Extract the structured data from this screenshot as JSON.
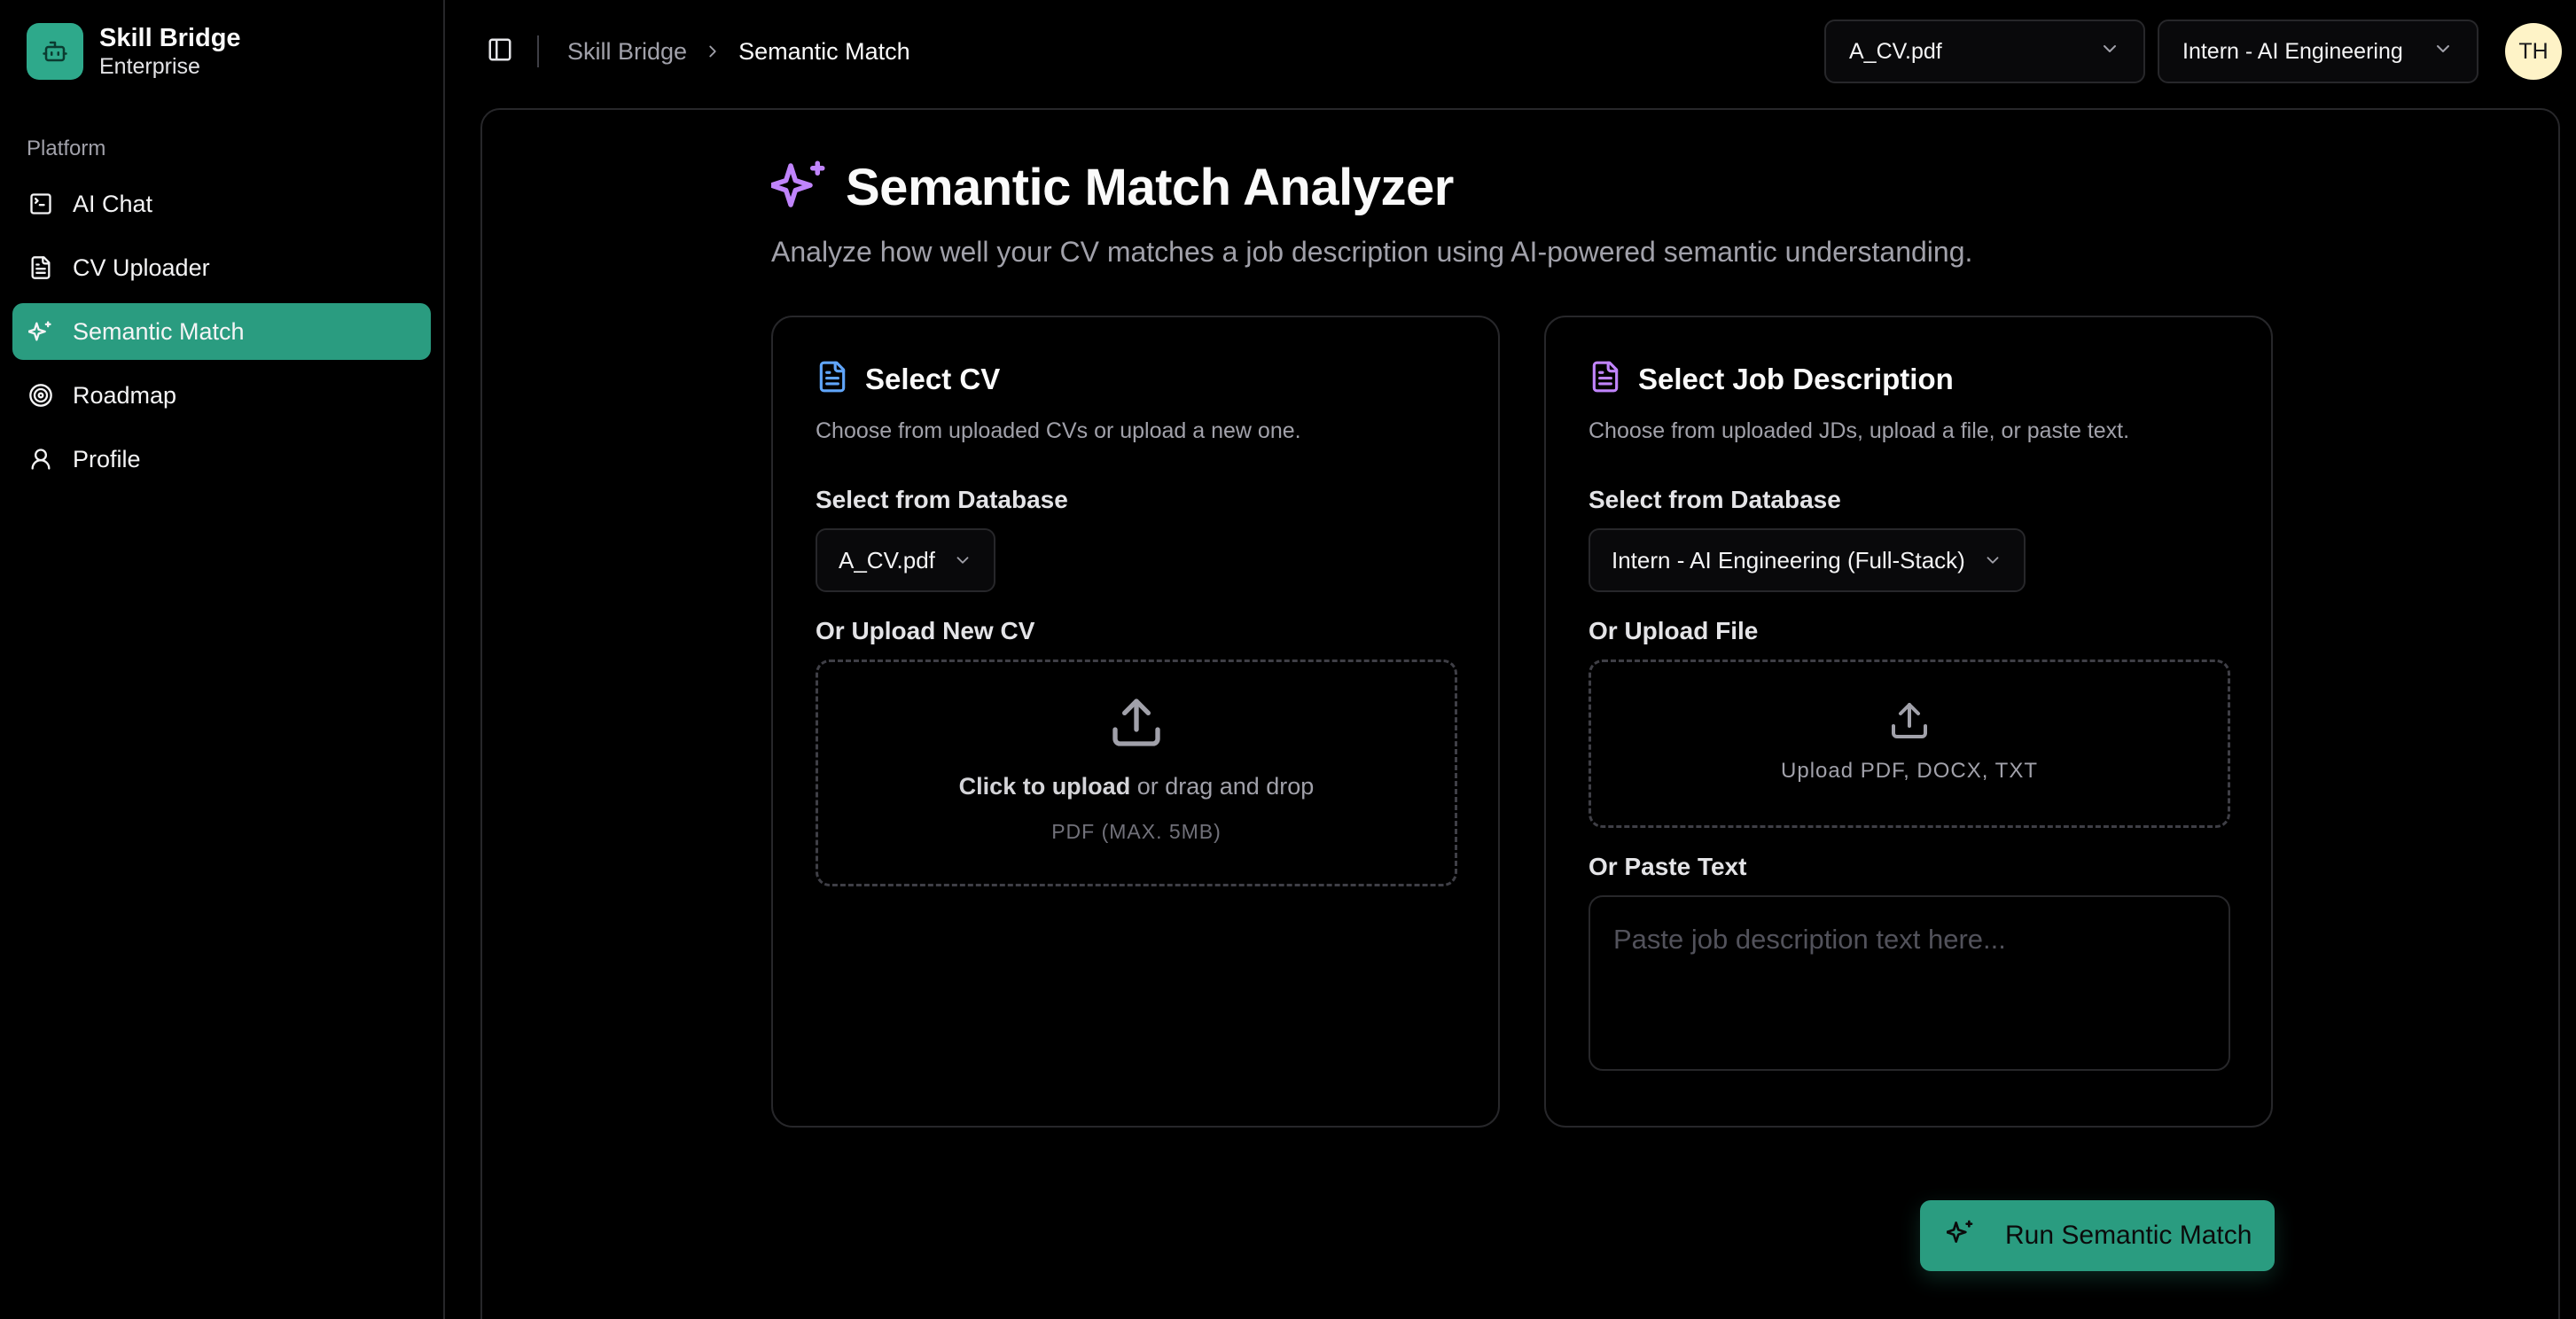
{
  "app": {
    "name": "Skill Bridge",
    "plan": "Enterprise"
  },
  "sidebar": {
    "group_label": "Platform",
    "items": [
      {
        "label": "AI Chat",
        "icon": "terminal-icon",
        "active": false
      },
      {
        "label": "CV Uploader",
        "icon": "file-icon",
        "active": false
      },
      {
        "label": "Semantic Match",
        "icon": "sparkles-icon",
        "active": true
      },
      {
        "label": "Roadmap",
        "icon": "target-icon",
        "active": false
      },
      {
        "label": "Profile",
        "icon": "user-icon",
        "active": false
      }
    ]
  },
  "header": {
    "breadcrumb": [
      "Skill Bridge",
      "Semantic Match"
    ],
    "cv_select": "A_CV.pdf",
    "jd_select": "Intern - AI Engineering",
    "avatar_initials": "TH"
  },
  "page": {
    "title": "Semantic Match Analyzer",
    "subtitle": "Analyze how well your CV matches a job description using AI-powered semantic understanding."
  },
  "cv_card": {
    "title": "Select CV",
    "description": "Choose from uploaded CVs or upload a new one.",
    "db_label": "Select from Database",
    "db_value": "A_CV.pdf",
    "upload_label": "Or Upload New CV",
    "upload_cta": "Click to upload",
    "upload_rest": " or drag and drop",
    "upload_hint": "PDF (MAX. 5MB)"
  },
  "jd_card": {
    "title": "Select Job Description",
    "description": "Choose from uploaded JDs, upload a file, or paste text.",
    "db_label": "Select from Database",
    "db_value": "Intern - AI Engineering (Full-Stack)",
    "upload_label": "Or Upload File",
    "upload_hint": "Upload PDF, DOCX, TXT",
    "paste_label": "Or Paste Text",
    "paste_placeholder": "Paste job description text here...",
    "paste_value": ""
  },
  "actions": {
    "run_label": "Run Semantic Match"
  },
  "colors": {
    "accent": "#2a9c80",
    "cv_icon": "#60a5fa",
    "jd_icon": "#c084fc",
    "title_icon": "#c084fc"
  }
}
